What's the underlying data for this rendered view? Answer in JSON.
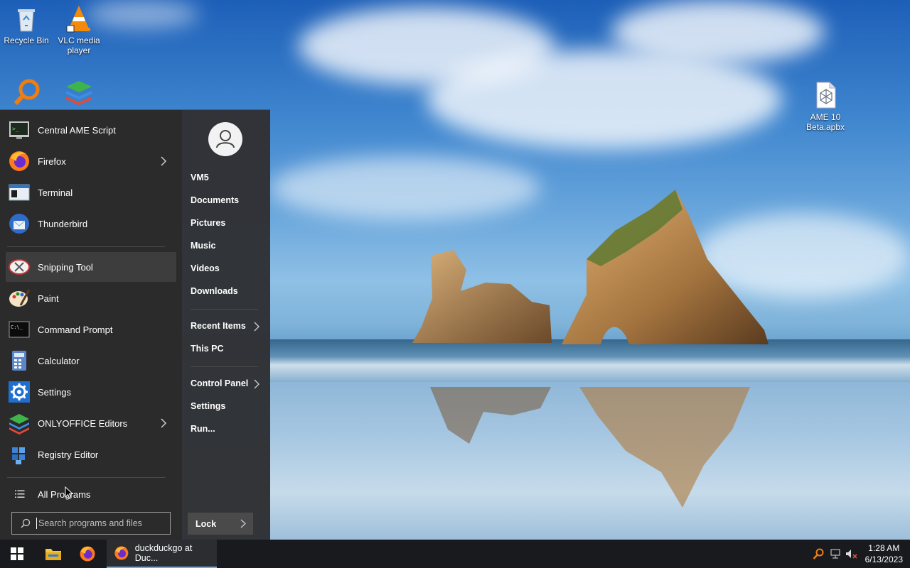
{
  "desktop": {
    "icons": [
      {
        "label": "Recycle Bin",
        "icon": "recycle-bin-icon"
      },
      {
        "label": "VLC media player",
        "icon": "vlc-icon"
      },
      {
        "label": "",
        "icon": "search-app-icon"
      },
      {
        "label": "",
        "icon": "onlyoffice-icon"
      },
      {
        "label": "AME 10 Beta.apbx",
        "icon": "apbx-file-icon"
      }
    ]
  },
  "start_menu": {
    "apps": [
      {
        "label": "Central AME Script",
        "icon": "terminal-monitor-icon",
        "has_submenu": false
      },
      {
        "label": "Firefox",
        "icon": "firefox-icon",
        "has_submenu": true
      },
      {
        "label": "Terminal",
        "icon": "terminal-icon",
        "has_submenu": false
      },
      {
        "label": "Thunderbird",
        "icon": "thunderbird-icon",
        "has_submenu": false
      },
      {
        "label": "Snipping Tool",
        "icon": "snipping-tool-icon",
        "has_submenu": false,
        "highlighted": true
      },
      {
        "label": "Paint",
        "icon": "paint-icon",
        "has_submenu": false
      },
      {
        "label": "Command Prompt",
        "icon": "command-prompt-icon",
        "has_submenu": false
      },
      {
        "label": "Calculator",
        "icon": "calculator-icon",
        "has_submenu": false
      },
      {
        "label": "Settings",
        "icon": "gear-icon",
        "has_submenu": false
      },
      {
        "label": "ONLYOFFICE Editors",
        "icon": "onlyoffice-icon",
        "has_submenu": true
      },
      {
        "label": "Registry Editor",
        "icon": "registry-editor-icon",
        "has_submenu": false
      }
    ],
    "all_programs": "All Programs",
    "search_placeholder": "Search programs and files",
    "user_links": [
      "VM5",
      "Documents",
      "Pictures",
      "Music",
      "Videos",
      "Downloads"
    ],
    "system_links": [
      {
        "label": "Recent Items",
        "has_submenu": true
      },
      {
        "label": "This PC",
        "has_submenu": false
      }
    ],
    "settings_links": [
      {
        "label": "Control Panel",
        "has_submenu": true
      },
      {
        "label": "Settings",
        "has_submenu": false
      },
      {
        "label": "Run...",
        "has_submenu": false
      }
    ],
    "lock_label": "Lock"
  },
  "taskbar": {
    "active_window_title": "duckduckgo at Duc...",
    "clock_time": "1:28 AM",
    "clock_date": "6/13/2023"
  },
  "colors": {
    "menu_bg": "#2b2b2b",
    "taskbar_bg": "#181a1e",
    "accent": "#6ea8e8"
  }
}
